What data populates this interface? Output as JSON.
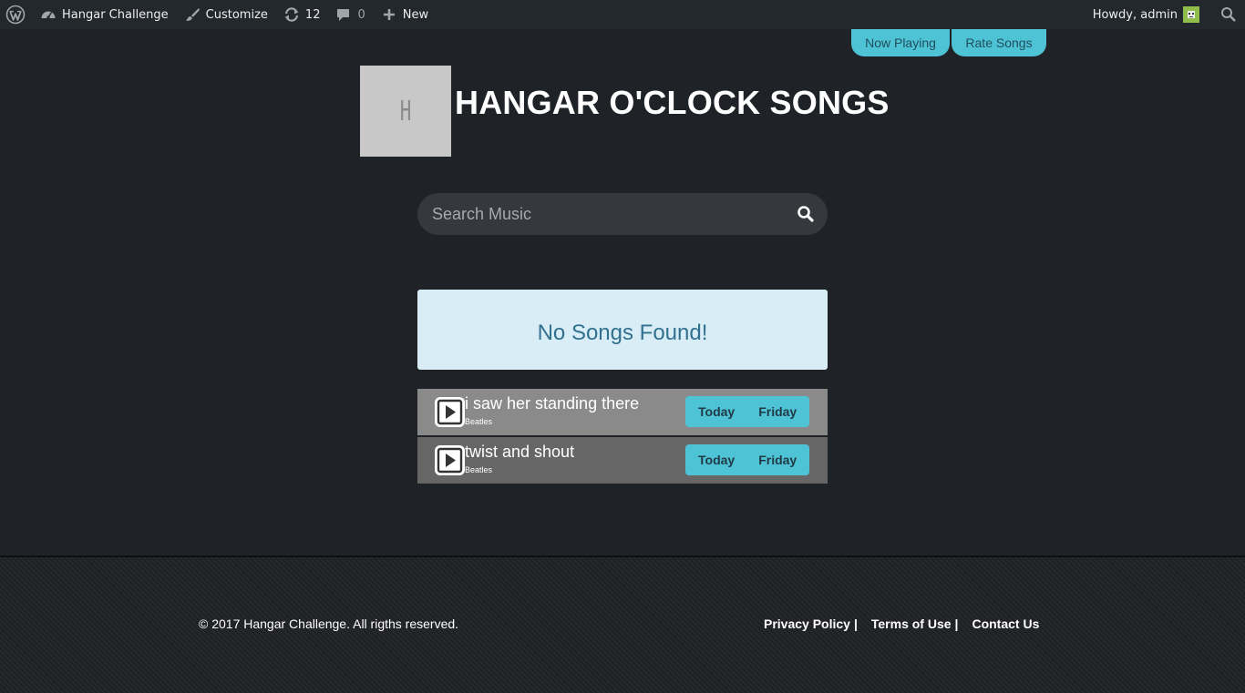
{
  "adminbar": {
    "site_name": "Hangar Challenge",
    "customize": "Customize",
    "updates_count": "12",
    "comments_count": "0",
    "new": "New",
    "howdy": "Howdy, admin"
  },
  "nav": {
    "now_playing": "Now Playing",
    "rate_songs": "Rate Songs"
  },
  "header": {
    "logo_letter": "H",
    "title": "HANGAR O'CLOCK SONGS"
  },
  "search": {
    "placeholder": "Search Music"
  },
  "alert": {
    "message": "No Songs Found!"
  },
  "songs": [
    {
      "title": "i saw her standing there",
      "artist": "Beatles",
      "today": "Today",
      "friday": "Friday"
    },
    {
      "title": "twist and shout",
      "artist": "Beatles",
      "today": "Today",
      "friday": "Friday"
    }
  ],
  "colors": {
    "accent": "#4fc3d6",
    "background": "#1f2226",
    "alert_bg": "#d9edf7",
    "alert_text": "#31708f",
    "row_odd": "#8a8a8a",
    "row_even": "#666666"
  },
  "footer": {
    "copyright": "© 2017 Hangar Challenge. All rigths reserved.",
    "links": [
      "Privacy Policy",
      "Terms of Use",
      "Contact Us"
    ],
    "separator": "|"
  }
}
